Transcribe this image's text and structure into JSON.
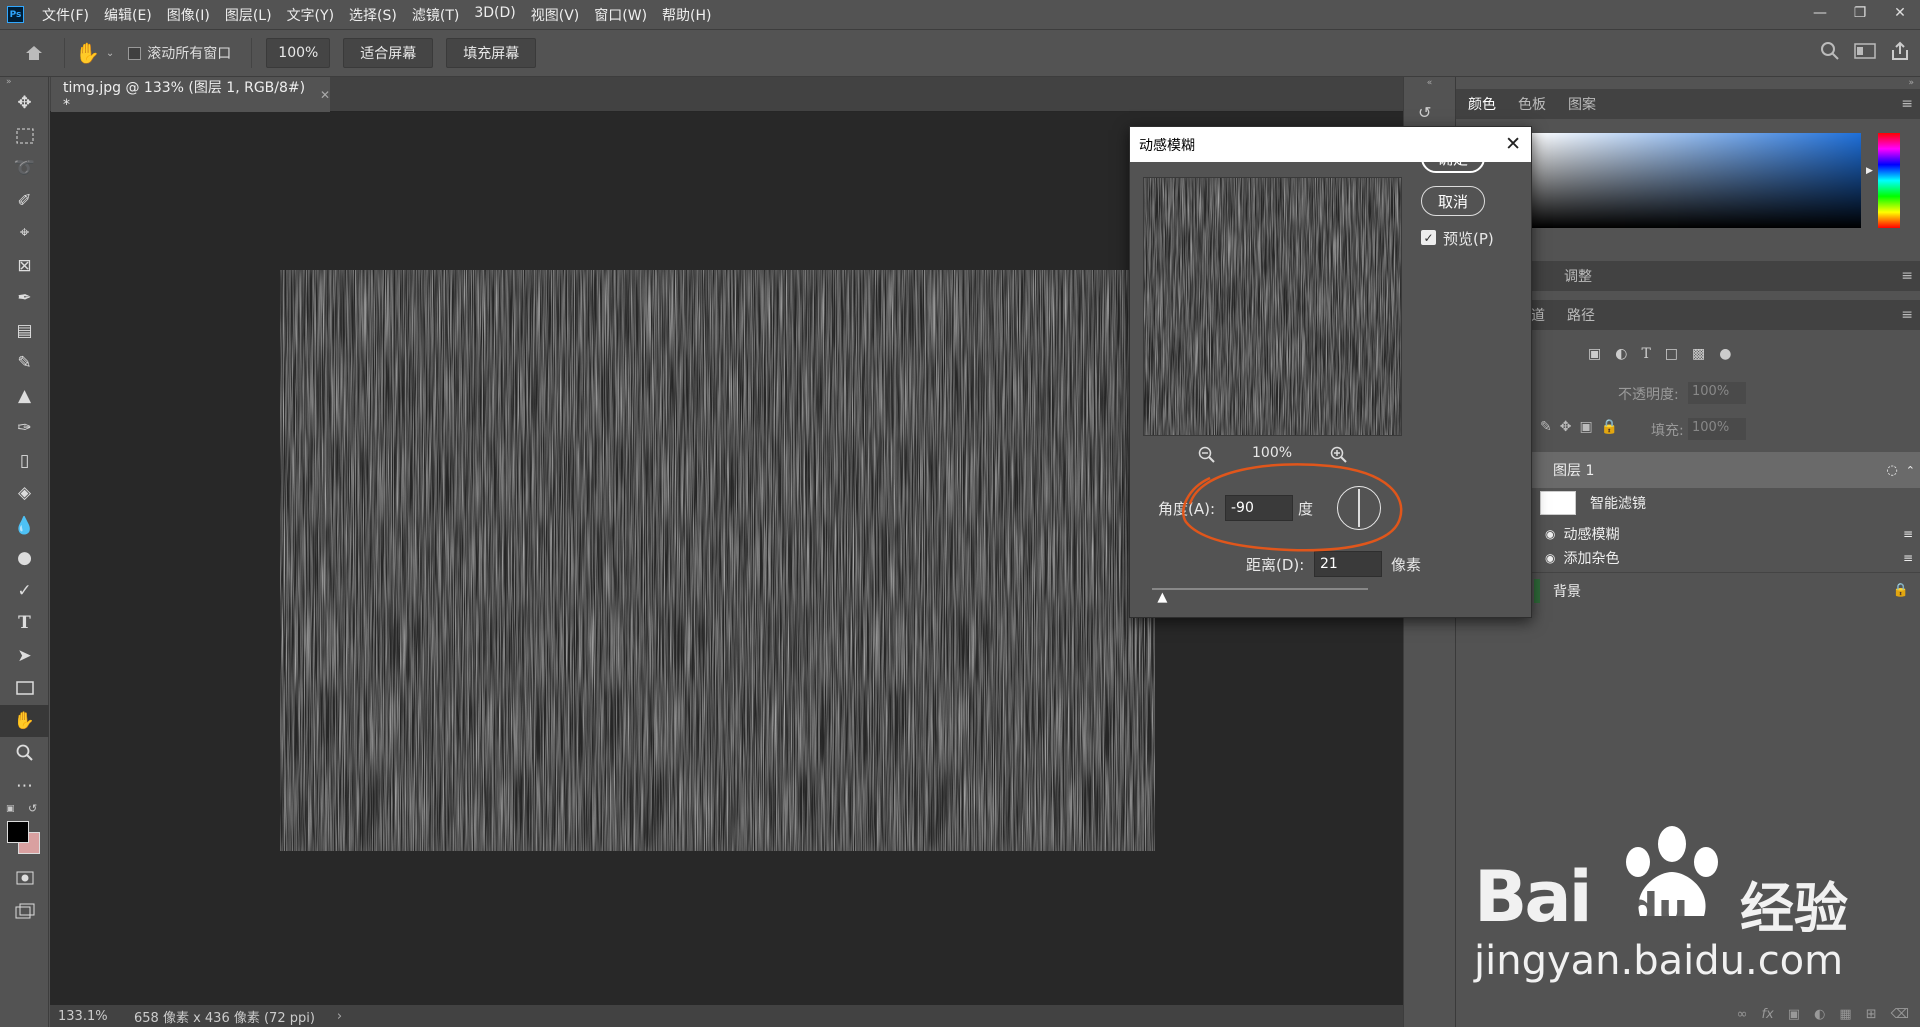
{
  "app": {
    "logo": "Ps"
  },
  "menu": [
    "文件(F)",
    "编辑(E)",
    "图像(I)",
    "图层(L)",
    "文字(Y)",
    "选择(S)",
    "滤镜(T)",
    "3D(D)",
    "视图(V)",
    "窗口(W)",
    "帮助(H)"
  ],
  "options": {
    "scroll_all_label": "滚动所有窗口",
    "zoom_value": "100%",
    "fit_screen": "适合屏幕",
    "fill_screen": "填充屏幕"
  },
  "document": {
    "tab_title": "timg.jpg @ 133% (图层 1, RGB/8#) *"
  },
  "status": {
    "zoom": "133.1%",
    "info": "658 像素 x 436 像素 (72 ppi)"
  },
  "panels": {
    "color_tabs": [
      "颜色",
      "色板",
      "图案"
    ],
    "adjust_tab": "调整",
    "layer_tabs": [
      "道",
      "路径"
    ],
    "opacity_label": "不透明度:",
    "opacity_value": "100%",
    "fill_label": "填充:",
    "fill_value": "100%"
  },
  "layers": {
    "layer1": "图层 1",
    "smart_filters": "智能滤镜",
    "filter1": "动感模糊",
    "filter2": "添加杂色",
    "background": "背景"
  },
  "dialog": {
    "title": "动感模糊",
    "ok": "确定",
    "cancel": "取消",
    "preview_label": "预览(P)",
    "preview_checked": true,
    "zoom": "100%",
    "angle_label": "角度(A):",
    "angle_value": "-90",
    "angle_unit": "度",
    "distance_label": "距离(D):",
    "distance_value": "21",
    "distance_unit": "像素",
    "distance_slider_fraction": 0.025
  },
  "watermark": {
    "brand": "Bai",
    "brand2": "du",
    "suffix": "经验",
    "url": "jingyan.baidu.com"
  },
  "colors": {
    "annotation": "#e0561b",
    "foreground": "#000000",
    "background_swatch": "#d9a0a0"
  }
}
